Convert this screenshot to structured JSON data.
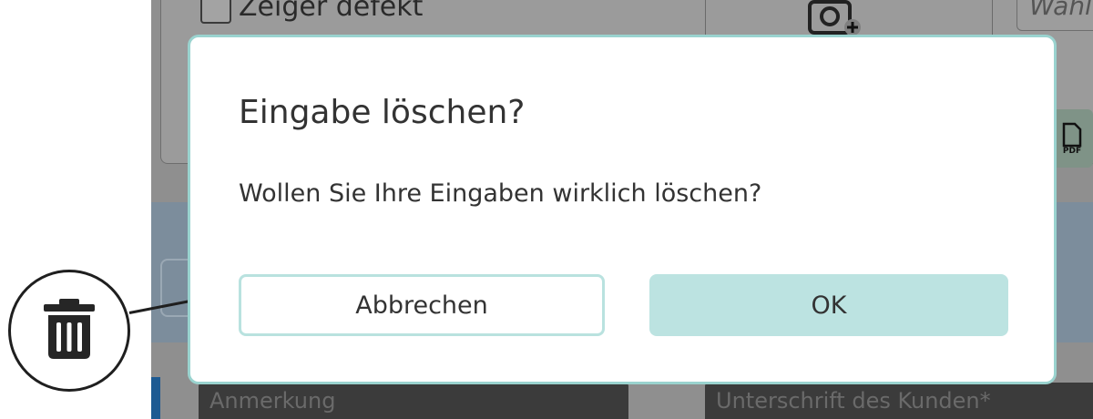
{
  "background": {
    "checkbox_label": "Zeiger defekt",
    "select_placeholder": "Wähl",
    "pdf_icon_label": "PDF",
    "note_field_placeholder": "Anmerkung",
    "signature_field_placeholder": "Unterschrift des Kunden*"
  },
  "dialog": {
    "title": "Eingabe löschen?",
    "message": "Wollen Sie Ihre Eingaben wirklich löschen?",
    "cancel_label": "Abbrechen",
    "ok_label": "OK"
  },
  "callout": {
    "icon": "trash-icon"
  },
  "colors": {
    "dialog_border": "#9ad3cf",
    "ok_button_bg": "#bce3e1",
    "cancel_button_border": "#b9e2df",
    "overlay_gray": "#8f8f8f",
    "text": "#333333"
  }
}
